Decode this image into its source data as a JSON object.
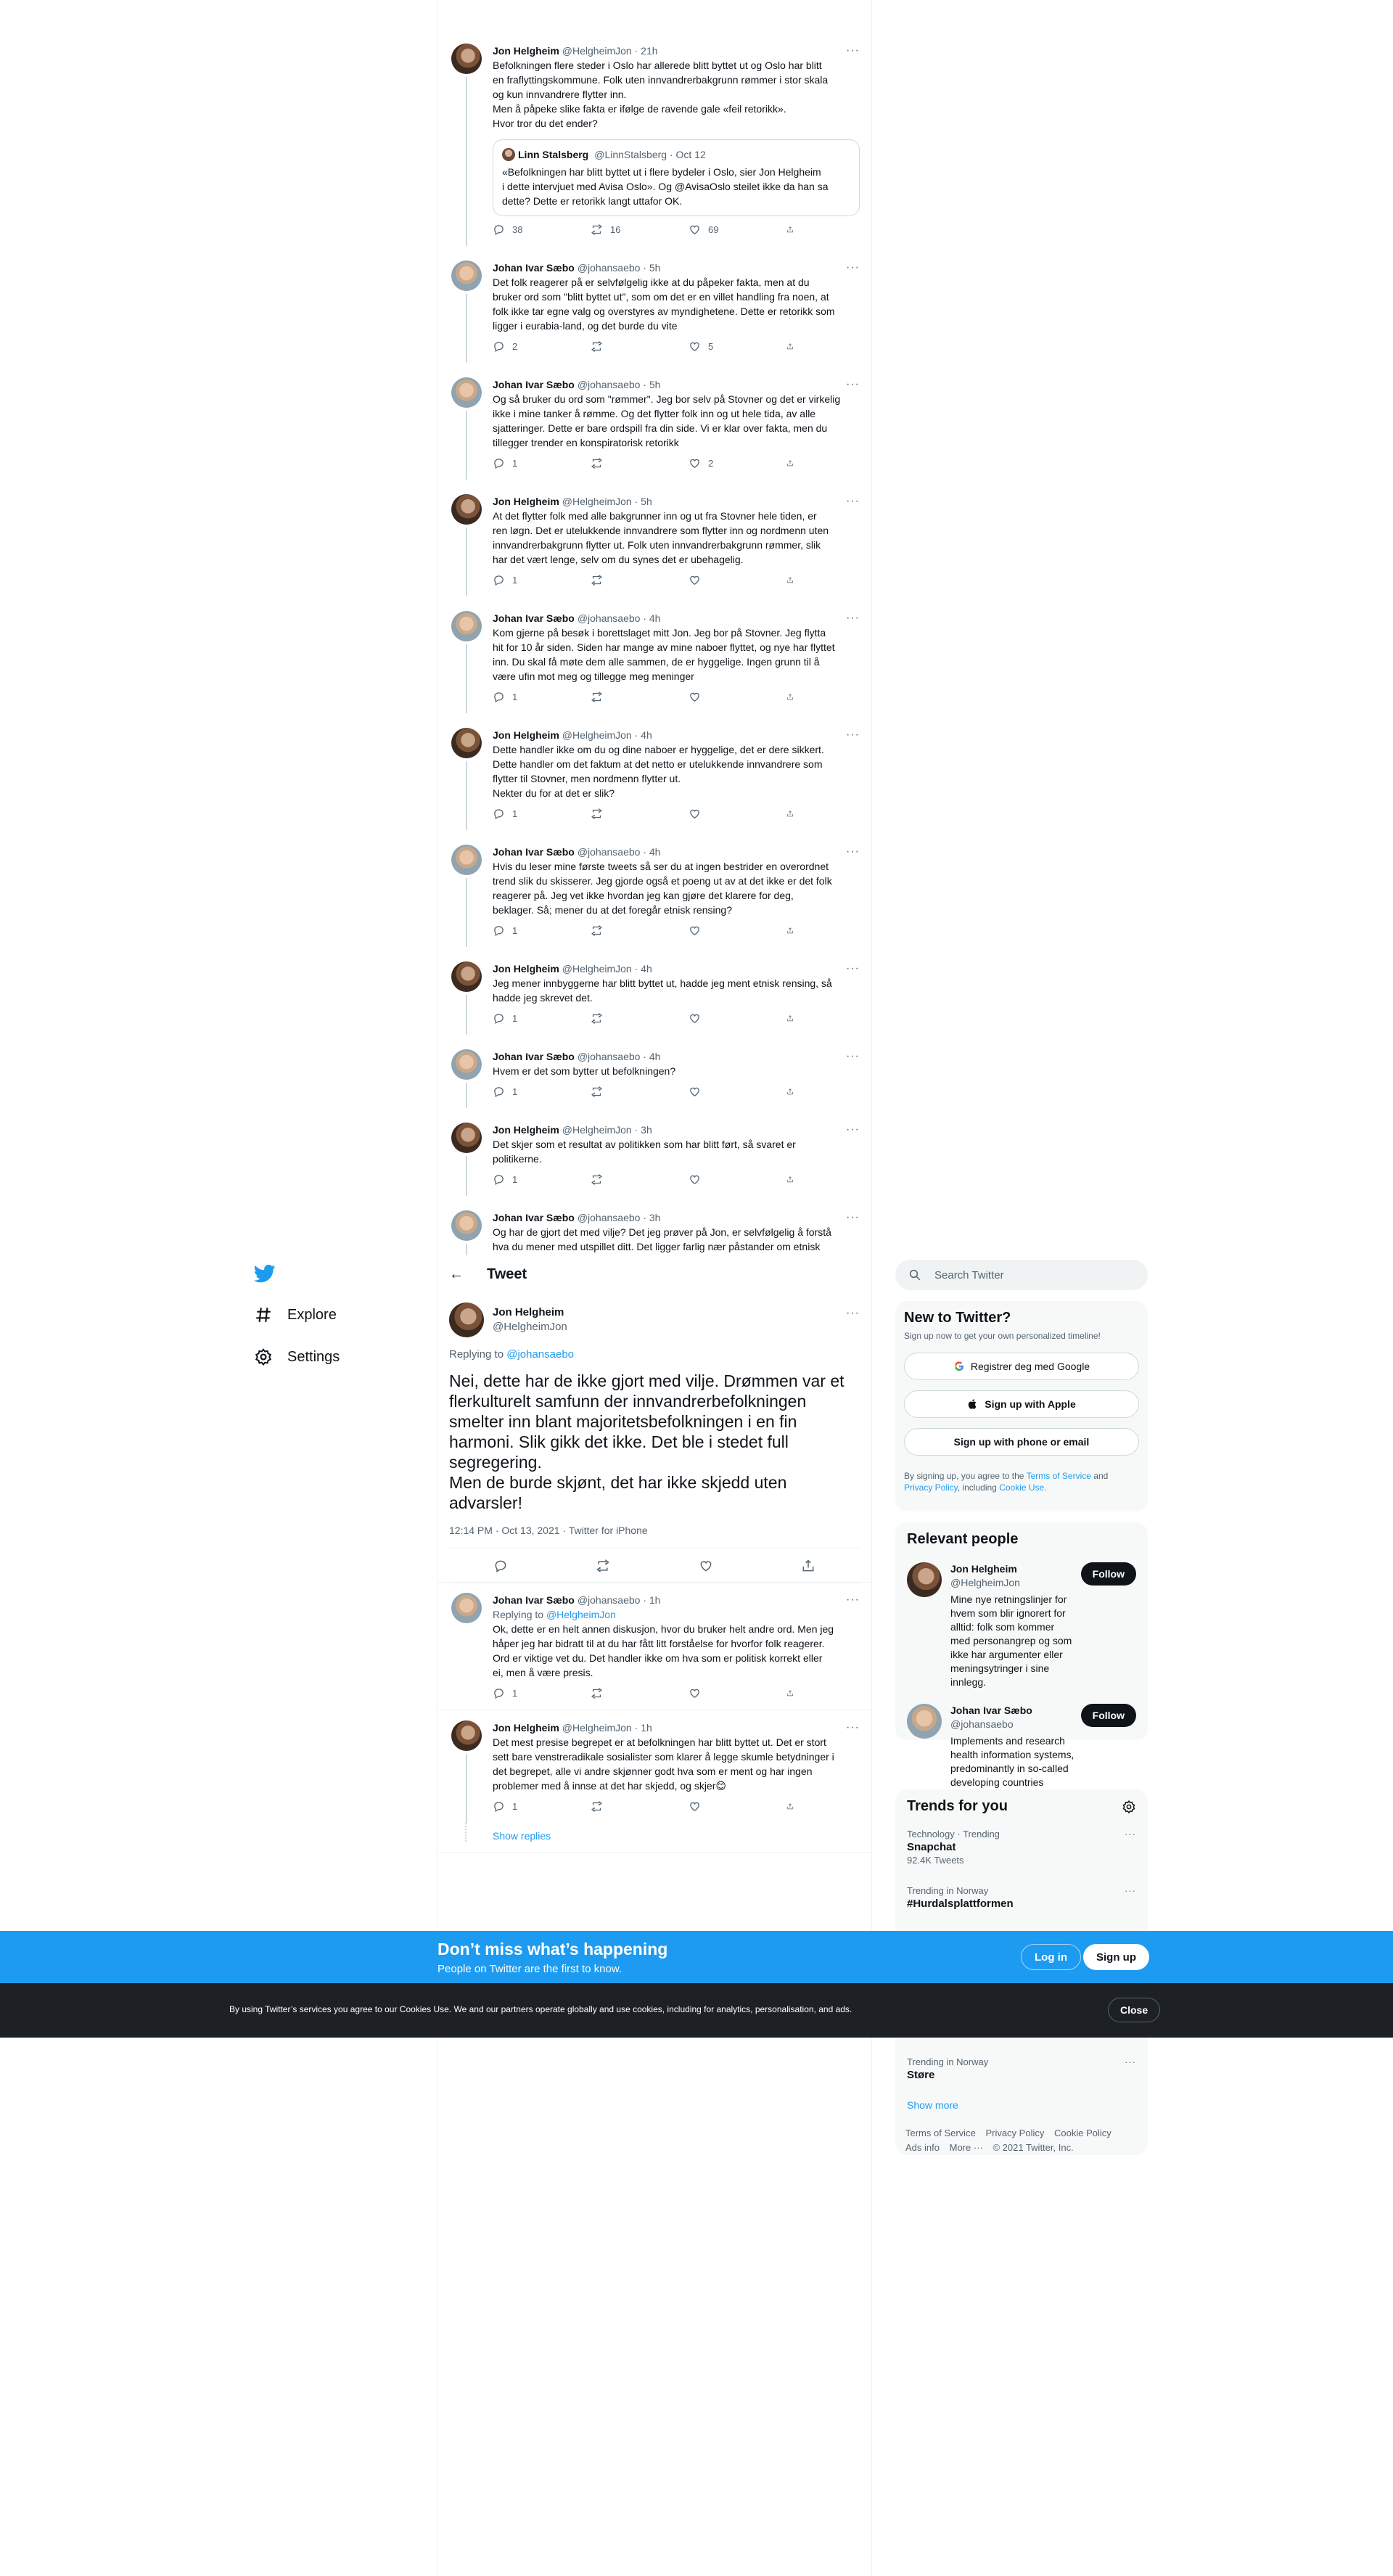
{
  "nav": {
    "explore": "Explore",
    "settings": "Settings"
  },
  "header": {
    "back": "←",
    "title": "Tweet"
  },
  "search": {
    "placeholder": "Search Twitter"
  },
  "thread": [
    {
      "who": "jon",
      "name": "Jon Helgheim",
      "handle": "@HelgheimJon · 21h",
      "text": "Befolkningen flere steder i Oslo har allerede blitt byttet ut og Oslo har blitt\nen fraflyttingskommune. Folk uten innvandrerbakgrunn rømmer i stor skala\nog kun innvandrere flytter inn.\nMen å påpeke slike fakta er ifølge de ravende gale «feil retorikk».\nHvor tror du det ender?",
      "quote": {
        "name": "Linn Stalsberg",
        "handle": "@LinnStalsberg · Oct 12",
        "text": "«Befolkningen har blitt byttet ut i flere bydeler i Oslo, sier Jon Helgheim\ni dette intervjuet med Avisa Oslo». Og @AvisaOslo steilet ikke da han sa\ndette? Dette er retorikk langt uttafor OK."
      },
      "reply": "38",
      "rt": "16",
      "like": "69"
    },
    {
      "who": "johan",
      "name": "Johan Ivar Sæbo",
      "handle": "@johansaebo · 5h",
      "text": "Det folk reagerer på er selvfølgelig ikke at du påpeker fakta, men at du\nbruker ord som \"blitt byttet ut\", som om det er en villet handling fra noen, at\nfolk ikke tar egne valg og overstyres av myndighetene. Dette er retorikk som\nligger i eurabia-land, og det burde du vite",
      "reply": "2",
      "rt": "",
      "like": "5"
    },
    {
      "who": "johan",
      "name": "Johan Ivar Sæbo",
      "handle": "@johansaebo · 5h",
      "text": "Og så bruker du ord som \"rømmer\". Jeg bor selv på Stovner og det er virkelig\nikke i mine tanker å rømme. Og det flytter folk inn og ut hele tida, av alle\nsjatteringer. Dette er bare ordspill fra din side. Vi er klar over fakta, men du\ntillegger trender en konspiratorisk retorikk",
      "reply": "1",
      "rt": "",
      "like": "2"
    },
    {
      "who": "jon",
      "name": "Jon Helgheim",
      "handle": "@HelgheimJon · 5h",
      "text": "At det flytter folk med alle bakgrunner inn og ut fra Stovner hele tiden, er\nren løgn. Det er utelukkende innvandrere som flytter inn og nordmenn uten\ninnvandrerbakgrunn flytter ut. Folk uten innvandrerbakgrunn rømmer, slik\nhar det vært lenge, selv om du synes det er ubehagelig.",
      "reply": "1",
      "rt": "",
      "like": ""
    },
    {
      "who": "johan",
      "name": "Johan Ivar Sæbo",
      "handle": "@johansaebo · 4h",
      "text": "Kom gjerne på besøk i borettslaget mitt Jon. Jeg bor på Stovner. Jeg flytta\nhit for 10 år siden. Siden har mange av mine naboer flyttet, og nye har flyttet\ninn. Du skal få møte dem alle sammen, de er hyggelige. Ingen grunn til å\nvære ufin mot meg og tillegge meg meninger",
      "reply": "1",
      "rt": "",
      "like": ""
    },
    {
      "who": "jon",
      "name": "Jon Helgheim",
      "handle": "@HelgheimJon · 4h",
      "text": "Dette handler ikke om du og dine naboer er hyggelige, det er dere sikkert.\nDette handler om det faktum at det netto er utelukkende innvandrere som\nflytter til Stovner, men nordmenn flytter ut.\nNekter du for at det er slik?",
      "reply": "1",
      "rt": "",
      "like": ""
    },
    {
      "who": "johan",
      "name": "Johan Ivar Sæbo",
      "handle": "@johansaebo · 4h",
      "text": "Hvis du leser mine første tweets så ser du at ingen bestrider en overordnet\ntrend slik du skisserer. Jeg gjorde også et poeng ut av at det ikke er det folk\nreagerer på. Jeg vet ikke hvordan jeg kan gjøre det klarere for deg,\nbeklager. Så; mener du at det foregår etnisk rensing?",
      "reply": "1",
      "rt": "",
      "like": ""
    },
    {
      "who": "jon",
      "name": "Jon Helgheim",
      "handle": "@HelgheimJon · 4h",
      "text": "Jeg mener innbyggerne har blitt byttet ut, hadde jeg ment etnisk rensing, så\nhadde jeg skrevet det.",
      "reply": "1",
      "rt": "",
      "like": ""
    },
    {
      "who": "johan",
      "name": "Johan Ivar Sæbo",
      "handle": "@johansaebo · 4h",
      "text": "Hvem er det som bytter ut befolkningen?",
      "reply": "1",
      "rt": "",
      "like": ""
    },
    {
      "who": "jon",
      "name": "Jon Helgheim",
      "handle": "@HelgheimJon · 3h",
      "text": "Det skjer som et resultat av politikken som har blitt ført, så svaret er\npolitikerne.",
      "reply": "1",
      "rt": "",
      "like": ""
    },
    {
      "who": "johan",
      "name": "Johan Ivar Sæbo",
      "handle": "@johansaebo · 3h",
      "text": "Og har de gjort det med vilje? Det jeg prøver på Jon, er selvfølgelig å forstå\nhva du mener med utspillet ditt. Det ligger farlig nær påstander om etnisk\nrensing. Man kan f.eks fint si at politikk fører til segregering. Men du bruker\nbevisst (?) ord som \"byttet ut\".",
      "reply": "",
      "rt": "",
      "like": ""
    }
  ],
  "focus": {
    "name": "Jon Helgheim",
    "handle": "@HelgheimJon",
    "replying_label": "Replying to",
    "replying_to": "@johansaebo",
    "text": "Nei, dette har de ikke gjort med vilje. Drømmen var et\nflerkulturelt samfunn der innvandrerbefolkningen\nsmelter inn blant majoritetsbefolkningen i en fin\nharmoni. Slik gikk det ikke. Det ble i stedet full\nsegregering.\nMen de burde skjønt, det har ikke skjedd uten\nadvarsler!",
    "meta": "12:14 PM · Oct 13, 2021 · Twitter for iPhone"
  },
  "replies": [
    {
      "who": "johan",
      "name": "Johan Ivar Sæbo",
      "handle": "@johansaebo · 1h",
      "replying_label": "Replying to",
      "replying_to": "@HelgheimJon",
      "text": "Ok, dette er en helt annen diskusjon, hvor du bruker helt andre ord. Men jeg\nhåper jeg har bidratt til at du har fått litt forståelse for hvorfor folk reagerer.\nOrd er viktige vet du. Det handler ikke om hva som er politisk korrekt eller\nei, men å være presis.",
      "reply": "1",
      "rt": "",
      "like": ""
    },
    {
      "who": "jon",
      "name": "Jon Helgheim",
      "handle": "@HelgheimJon · 1h",
      "text": "Det mest presise begrepet er at befolkningen har blitt byttet ut. Det er stort\nsett bare venstreradikale sosialister som klarer å legge skumle betydninger i\ndet begrepet, alle vi andre skjønner godt hva som er ment og har ingen\nproblemer med å innse at det har skjedd, og skjer😊",
      "reply": "1",
      "rt": "",
      "like": ""
    }
  ],
  "show_replies": "Show replies",
  "new_to_twitter": {
    "title": "New to Twitter?",
    "sub": "Sign up now to get your own personalized timeline!",
    "google": "Registrer deg med Google",
    "apple": "Sign up with Apple",
    "phone": "Sign up with phone or email",
    "terms_pre": "By signing up, you agree to the",
    "terms_tos": "Terms of Service",
    "terms_and": "and",
    "terms_privacy": "Privacy Policy",
    "terms_incl": ", including",
    "terms_cookie": "Cookie Use."
  },
  "relevant": {
    "title": "Relevant people",
    "people": [
      {
        "who": "jon",
        "name": "Jon Helgheim",
        "handle": "@HelgheimJon",
        "follow": "Follow",
        "bio": "Mine nye retningslinjer for hvem som blir ignorert for alltid: folk som kommer med personangrep og som ikke har argumenter eller meningsytringer i sine innlegg."
      },
      {
        "who": "johan",
        "name": "Johan Ivar Sæbo",
        "handle": "@johansaebo",
        "follow": "Follow",
        "bio": "Implements and research health information systems, predominantly in so-called developing countries"
      }
    ]
  },
  "trends": {
    "title": "Trends for you",
    "items": [
      {
        "ctx": "Technology · Trending",
        "name": "Snapchat",
        "count": "92.4K Tweets"
      },
      {
        "ctx": "Trending in Norway",
        "name": "#Hurdalsplattformen",
        "count": ""
      },
      {
        "ctx": "Trending in Norway",
        "name": "Støre",
        "count": ""
      }
    ],
    "show_more": "Show more"
  },
  "footer": {
    "links": [
      "Terms of Service",
      "Privacy Policy",
      "Cookie Policy",
      "Ads info",
      "More ···",
      "© 2021 Twitter, Inc."
    ]
  },
  "banner": {
    "title": "Don’t miss what’s happening",
    "sub": "People on Twitter are the first to know.",
    "login": "Log in",
    "signup": "Sign up"
  },
  "cookie": {
    "text": "By using Twitter’s services you agree to our Cookies Use. We and our partners operate globally and use cookies, including for analytics, personalisation, and ads.",
    "close": "Close"
  },
  "colors": {
    "accent": "#1d9bf0",
    "text": "#0f1419",
    "muted": "#536471",
    "cookie_bg": "#1d2125"
  }
}
